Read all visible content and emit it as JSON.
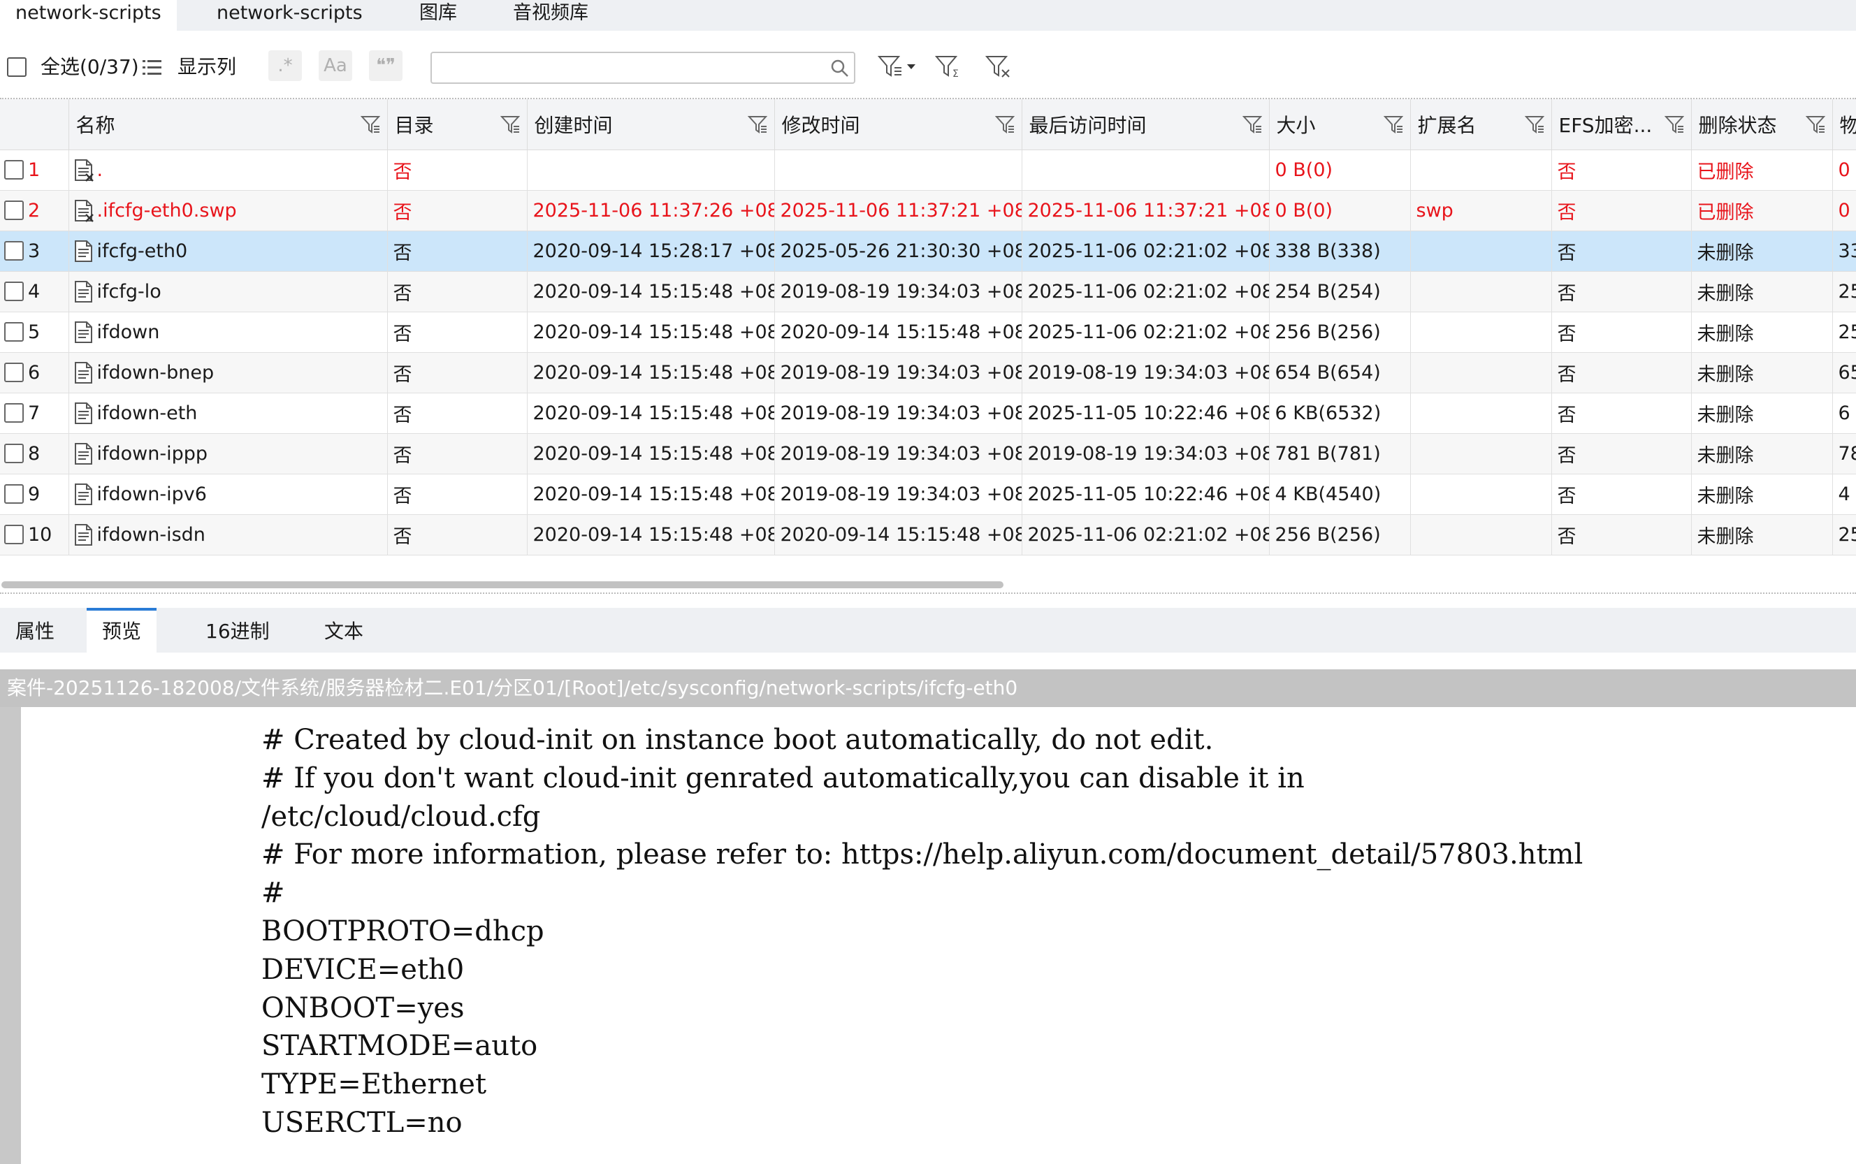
{
  "top_tabs": [
    "network-scripts",
    "network-scripts",
    "图库",
    "音视频库"
  ],
  "toolbar": {
    "select_all_label": "全选(0/37)",
    "show_columns_label": "显示列",
    "regex_btn": ".*",
    "case_btn": "Aa",
    "quote_btn": "❝❞",
    "search_placeholder": "",
    "search_value": ""
  },
  "table": {
    "columns": [
      "",
      "名称",
      "目录",
      "创建时间",
      "修改时间",
      "最后访问时间",
      "大小",
      "扩展名",
      "EFS加密...",
      "删除状态",
      "物"
    ],
    "rows": [
      {
        "idx": "1",
        "name": ".",
        "dir": "否",
        "created": "",
        "modified": "",
        "accessed": "",
        "size": "0 B(0)",
        "ext": "",
        "efs": "否",
        "status": "已删除",
        "extra": "0",
        "deleted": true
      },
      {
        "idx": "2",
        "name": ".ifcfg-eth0.swp",
        "dir": "否",
        "created": "2025-11-06 11:37:26 +08",
        "modified": "2025-11-06 11:37:21 +08",
        "accessed": "2025-11-06 11:37:21 +08",
        "size": "0 B(0)",
        "ext": "swp",
        "efs": "否",
        "status": "已删除",
        "extra": "0",
        "deleted": true
      },
      {
        "idx": "3",
        "name": "ifcfg-eth0",
        "dir": "否",
        "created": "2020-09-14 15:28:17 +08",
        "modified": "2025-05-26 21:30:30 +08",
        "accessed": "2025-11-06 02:21:02 +08",
        "size": "338 B(338)",
        "ext": "",
        "efs": "否",
        "status": "未删除",
        "extra": "33",
        "selected": true
      },
      {
        "idx": "4",
        "name": "ifcfg-lo",
        "dir": "否",
        "created": "2020-09-14 15:15:48 +08",
        "modified": "2019-08-19 19:34:03 +08",
        "accessed": "2025-11-06 02:21:02 +08",
        "size": "254 B(254)",
        "ext": "",
        "efs": "否",
        "status": "未删除",
        "extra": "25"
      },
      {
        "idx": "5",
        "name": "ifdown",
        "dir": "否",
        "created": "2020-09-14 15:15:48 +08",
        "modified": "2020-09-14 15:15:48 +08",
        "accessed": "2025-11-06 02:21:02 +08",
        "size": "256 B(256)",
        "ext": "",
        "efs": "否",
        "status": "未删除",
        "extra": "25"
      },
      {
        "idx": "6",
        "name": "ifdown-bnep",
        "dir": "否",
        "created": "2020-09-14 15:15:48 +08",
        "modified": "2019-08-19 19:34:03 +08",
        "accessed": "2019-08-19 19:34:03 +08",
        "size": "654 B(654)",
        "ext": "",
        "efs": "否",
        "status": "未删除",
        "extra": "65"
      },
      {
        "idx": "7",
        "name": "ifdown-eth",
        "dir": "否",
        "created": "2020-09-14 15:15:48 +08",
        "modified": "2019-08-19 19:34:03 +08",
        "accessed": "2025-11-05 10:22:46 +08",
        "size": "6 KB(6532)",
        "ext": "",
        "efs": "否",
        "status": "未删除",
        "extra": "6"
      },
      {
        "idx": "8",
        "name": "ifdown-ippp",
        "dir": "否",
        "created": "2020-09-14 15:15:48 +08",
        "modified": "2019-08-19 19:34:03 +08",
        "accessed": "2019-08-19 19:34:03 +08",
        "size": "781 B(781)",
        "ext": "",
        "efs": "否",
        "status": "未删除",
        "extra": "78"
      },
      {
        "idx": "9",
        "name": "ifdown-ipv6",
        "dir": "否",
        "created": "2020-09-14 15:15:48 +08",
        "modified": "2019-08-19 19:34:03 +08",
        "accessed": "2025-11-05 10:22:46 +08",
        "size": "4 KB(4540)",
        "ext": "",
        "efs": "否",
        "status": "未删除",
        "extra": "4"
      },
      {
        "idx": "10",
        "name": "ifdown-isdn",
        "dir": "否",
        "created": "2020-09-14 15:15:48 +08",
        "modified": "2020-09-14 15:15:48 +08",
        "accessed": "2025-11-06 02:21:02 +08",
        "size": "256 B(256)",
        "ext": "",
        "efs": "否",
        "status": "未删除",
        "extra": "25"
      }
    ]
  },
  "bottom_tabs": [
    "属性",
    "预览",
    "16进制",
    "文本"
  ],
  "path": "案件-20251126-182008/文件系统/服务器检材二.E01/分区01/[Root]/etc/sysconfig/network-scripts/ifcfg-eth0",
  "preview_lines": [
    "# Created by cloud-init on instance boot automatically, do not edit.",
    "# If you don't want cloud-init genrated automatically,you can disable it in",
    "/etc/cloud/cloud.cfg",
    "# For more information, please refer to: https://help.aliyun.com/document_detail/57803.html",
    "#",
    "BOOTPROTO=dhcp",
    "DEVICE=eth0",
    "ONBOOT=yes",
    "STARTMODE=auto",
    "TYPE=Ethernet",
    "USERCTL=no"
  ],
  "colors": {
    "deleted": "#e8141b",
    "selected_row": "#cce6fa",
    "active_tab_border": "#2a7cd6"
  }
}
